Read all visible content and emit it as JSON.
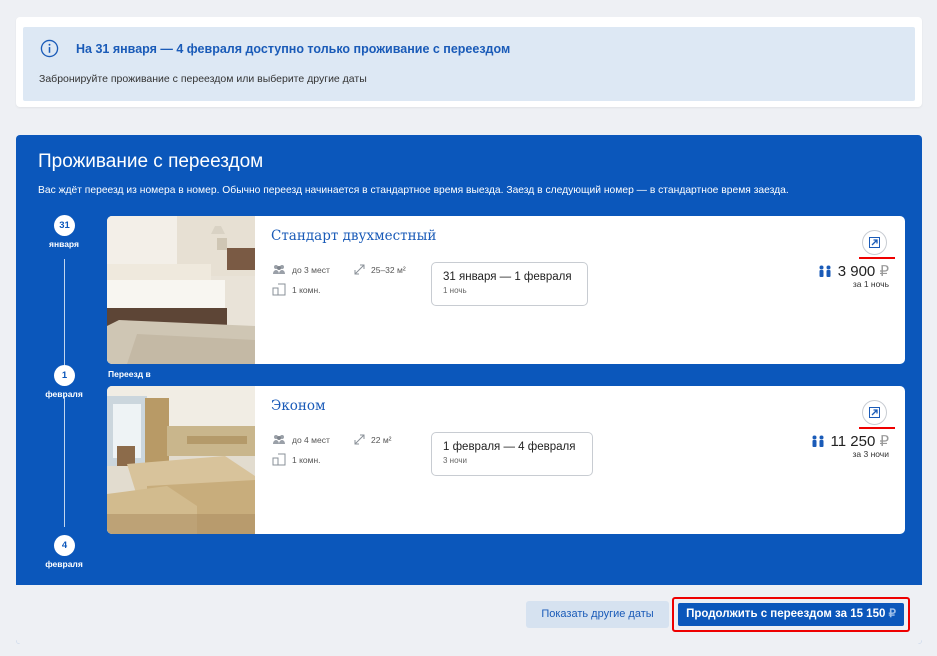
{
  "notice": {
    "title": "На 31 января — 4 февраля доступно только проживание с переездом",
    "text": "Забронируйте проживание с переездом или выберите другие даты"
  },
  "panel": {
    "title": "Проживание с переездом",
    "description": "Вас ждёт переезд из номера в номер. Обычно переезд начинается в стандартное время выезда. Заезд в следующий номер — в стандартное время заезда."
  },
  "timeline": [
    {
      "day": "31",
      "month": "января"
    },
    {
      "day": "1",
      "month": "февраля"
    },
    {
      "day": "4",
      "month": "февраля"
    }
  ],
  "transfer_label": "Переезд в",
  "rooms": [
    {
      "name": "Стандарт двухместный",
      "guests": "до 3 мест",
      "area": "25–32 м²",
      "rooms": "1 комн.",
      "dates": "31 января — 1 февраля",
      "nights": "1 ночь",
      "price": "3 900",
      "currency": "₽",
      "price_note": "за 1 ночь"
    },
    {
      "name": "Эконом",
      "guests": "до 4 мест",
      "area": "22 м²",
      "rooms": "1 комн.",
      "dates": "1 февраля — 4 февраля",
      "nights": "3 ночи",
      "price": "11 250",
      "currency": "₽",
      "price_note": "за 3 ночи"
    }
  ],
  "buttons": {
    "other_dates": "Показать другие даты",
    "continue_label": "Продолжить с переездом за 15 150",
    "continue_currency": "₽"
  },
  "icons": [
    "info-icon",
    "guests-icon",
    "area-icon",
    "rooms-icon",
    "expand-icon",
    "people-icon"
  ],
  "colors": {
    "brand_blue": "#0b57bb",
    "link_blue": "#1a5bb8",
    "highlight_red": "#ee0000",
    "notice_bg": "#dde8f4"
  }
}
